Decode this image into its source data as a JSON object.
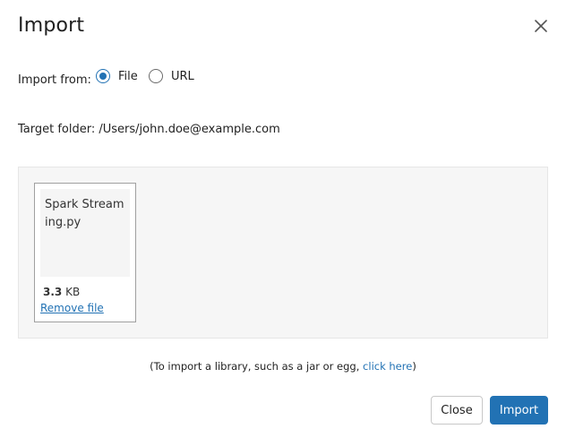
{
  "dialog": {
    "title": "Import",
    "close_icon": "close-icon"
  },
  "import_from": {
    "label": "Import from:",
    "options": [
      {
        "label": "File",
        "selected": true
      },
      {
        "label": "URL",
        "selected": false
      }
    ]
  },
  "target_folder": {
    "text": "Target folder: /Users/john.doe@example.com"
  },
  "file": {
    "name": "Spark Streaming.py",
    "size_value": "3.3",
    "size_unit": " KB",
    "remove_label": "Remove file"
  },
  "library_note": {
    "prefix": "(To import a library, such as a jar or egg, ",
    "link": "click here",
    "suffix": ")"
  },
  "buttons": {
    "close_label": "Close",
    "import_label": "Import"
  },
  "colors": {
    "accent": "#2272b4",
    "dropzone_bg": "#f6f6f6"
  }
}
